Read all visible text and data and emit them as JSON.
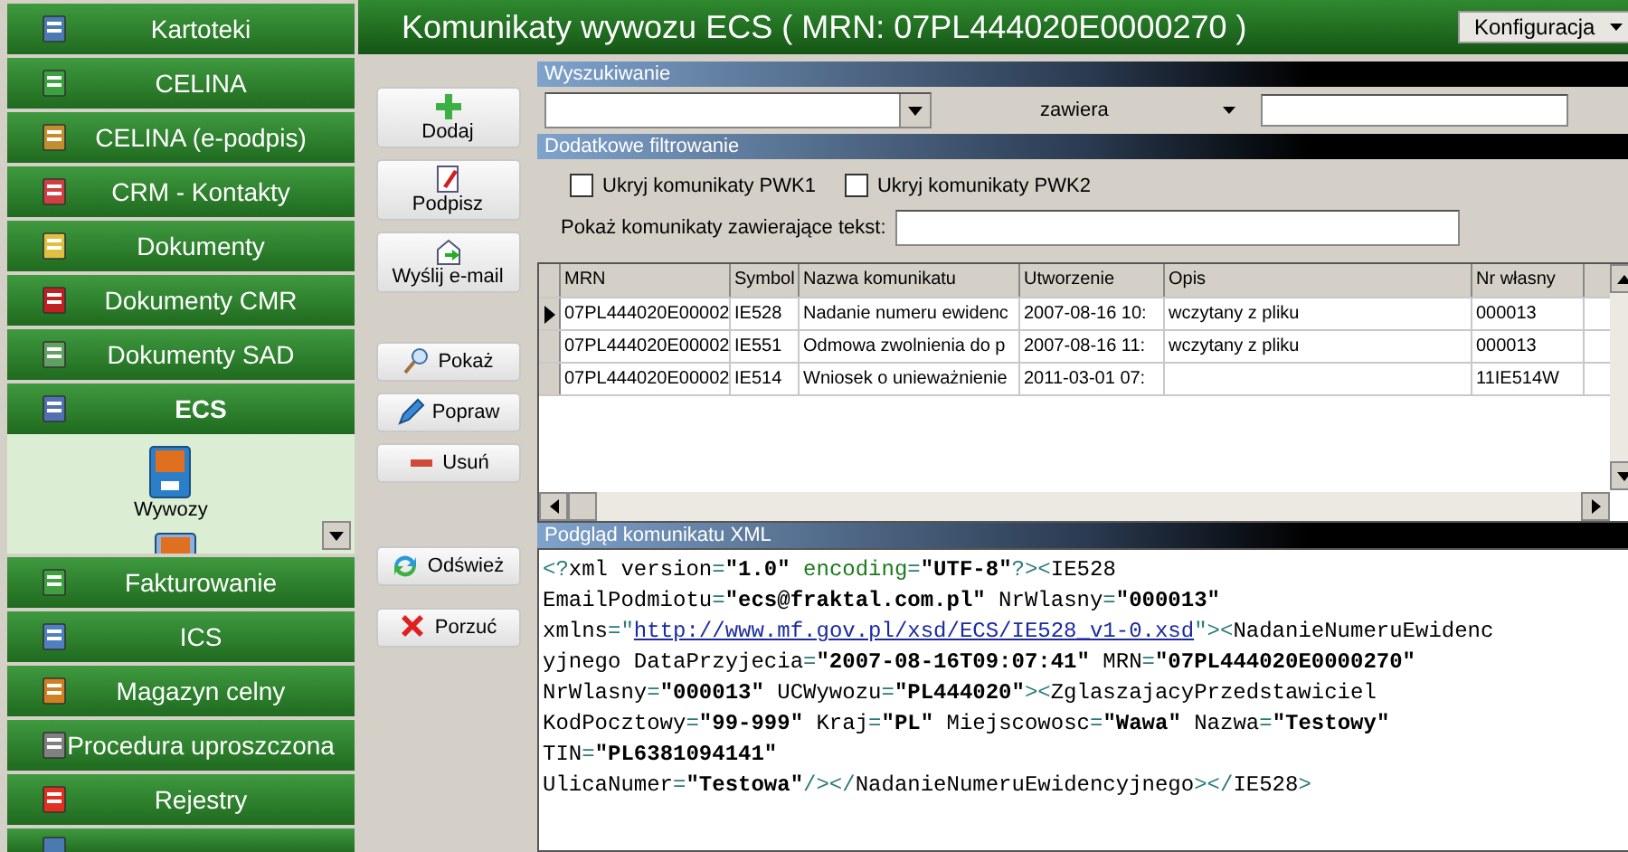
{
  "sidebar": {
    "items": [
      {
        "label": "Kartoteki",
        "expanded": false
      },
      {
        "label": "CELINA",
        "expanded": false
      },
      {
        "label": "CELINA (e-podpis)",
        "expanded": false
      },
      {
        "label": "CRM - Kontakty",
        "expanded": false
      },
      {
        "label": "Dokumenty",
        "expanded": false
      },
      {
        "label": "Dokumenty CMR",
        "expanded": false
      },
      {
        "label": "Dokumenty SAD",
        "expanded": false
      },
      {
        "label": "ECS",
        "expanded": true,
        "children": [
          {
            "label": "Wywozy"
          }
        ]
      },
      {
        "label": "Fakturowanie",
        "expanded": false
      },
      {
        "label": "ICS",
        "expanded": false
      },
      {
        "label": "Magazyn celny",
        "expanded": false
      },
      {
        "label": "Procedura uproszczona",
        "expanded": false
      },
      {
        "label": "Rejestry",
        "expanded": false
      }
    ]
  },
  "header": {
    "title": "Komunikaty wywozu ECS ( MRN: 07PL444020E0000270 )",
    "menu": "Konfiguracja"
  },
  "actions": [
    [
      {
        "label": "Dodaj",
        "kind": "add"
      },
      {
        "label": "Podpisz",
        "kind": "sign"
      },
      {
        "label": "Wyślij e-mail",
        "kind": "email"
      }
    ],
    [
      {
        "label": "Pokaż",
        "kind": "show"
      },
      {
        "label": "Popraw",
        "kind": "edit"
      },
      {
        "label": "Usuń",
        "kind": "delete"
      }
    ],
    [
      {
        "label": "Odśwież",
        "kind": "refresh"
      },
      {
        "label": "Porzuć",
        "kind": "discard"
      }
    ]
  ],
  "search": {
    "title": "Wyszukiwanie",
    "operator": "zawiera"
  },
  "filter": {
    "title": "Dodatkowe filtrowanie",
    "options": [
      {
        "label": "Ukryj komunikaty PWK1",
        "checked": false
      },
      {
        "label": "Ukryj komunikaty PWK2",
        "checked": false
      }
    ],
    "text_label": "Pokaż komunikaty zawierające tekst:"
  },
  "table": {
    "columns": [
      "MRN",
      "Symbol",
      "Nazwa komunikatu",
      "Utworzenie",
      "Opis",
      "Nr własny"
    ],
    "rows": [
      {
        "selected": true,
        "cells": [
          "07PL444020E00002",
          "IE528",
          "Nadanie numeru ewidenc",
          "2007-08-16 10:",
          "wczytany z pliku",
          "000013"
        ]
      },
      {
        "selected": false,
        "cells": [
          "07PL444020E00002",
          "IE551",
          "Odmowa zwolnienia do p",
          "2007-08-16 11:",
          "wczytany z pliku",
          "000013"
        ]
      },
      {
        "selected": false,
        "cells": [
          "07PL444020E00002",
          "IE514",
          "Wniosek o unieważnienie",
          "2011-03-01 07:",
          "",
          "11IE514W"
        ]
      }
    ]
  },
  "xml": {
    "title": "Podgląd komunikatu XML",
    "lines": [
      [
        {
          "kind": "p",
          "text": "<?"
        },
        {
          "kind": "n",
          "text": "xml version"
        },
        {
          "kind": "p",
          "text": "="
        },
        {
          "kind": "v",
          "text": "\"1.0\""
        },
        {
          "kind": "k",
          "text": " encoding"
        },
        {
          "kind": "p",
          "text": "="
        },
        {
          "kind": "v",
          "text": "\"UTF-8\""
        },
        {
          "kind": "p",
          "text": "?><"
        },
        {
          "kind": "n",
          "text": "IE528"
        }
      ],
      [
        {
          "kind": "n",
          "text": "EmailPodmiotu"
        },
        {
          "kind": "p",
          "text": "="
        },
        {
          "kind": "v",
          "text": "\"ecs@fraktal.com.pl\""
        },
        {
          "kind": "n",
          "text": " NrWlasny"
        },
        {
          "kind": "p",
          "text": "="
        },
        {
          "kind": "v",
          "text": "\"000013\""
        }
      ],
      [
        {
          "kind": "n",
          "text": "xmlns"
        },
        {
          "kind": "p",
          "text": "=\""
        },
        {
          "kind": "l",
          "text": "http://www.mf.gov.pl/xsd/ECS/IE528_v1-0.xsd"
        },
        {
          "kind": "p",
          "text": "\"><"
        },
        {
          "kind": "n",
          "text": "NadanieNumeruEwidenc"
        }
      ],
      [
        {
          "kind": "n",
          "text": "yjnego DataPrzyjecia"
        },
        {
          "kind": "p",
          "text": "="
        },
        {
          "kind": "v",
          "text": "\"2007-08-16T09:07:41\""
        },
        {
          "kind": "n",
          "text": " MRN"
        },
        {
          "kind": "p",
          "text": "="
        },
        {
          "kind": "v",
          "text": "\"07PL444020E0000270\""
        }
      ],
      [
        {
          "kind": "n",
          "text": "NrWlasny"
        },
        {
          "kind": "p",
          "text": "="
        },
        {
          "kind": "v",
          "text": "\"000013\""
        },
        {
          "kind": "n",
          "text": " UCWywozu"
        },
        {
          "kind": "p",
          "text": "="
        },
        {
          "kind": "v",
          "text": "\"PL444020\""
        },
        {
          "kind": "p",
          "text": "><"
        },
        {
          "kind": "n",
          "text": "ZglaszajacyPrzedstawiciel"
        }
      ],
      [
        {
          "kind": "n",
          "text": "KodPocztowy"
        },
        {
          "kind": "p",
          "text": "="
        },
        {
          "kind": "v",
          "text": "\"99-999\""
        },
        {
          "kind": "n",
          "text": " Kraj"
        },
        {
          "kind": "p",
          "text": "="
        },
        {
          "kind": "v",
          "text": "\"PL\""
        },
        {
          "kind": "n",
          "text": " Miejscowosc"
        },
        {
          "kind": "p",
          "text": "="
        },
        {
          "kind": "v",
          "text": "\"Wawa\""
        },
        {
          "kind": "n",
          "text": " Nazwa"
        },
        {
          "kind": "p",
          "text": "="
        },
        {
          "kind": "v",
          "text": "\"Testowy\""
        }
      ],
      [
        {
          "kind": "n",
          "text": "TIN"
        },
        {
          "kind": "p",
          "text": "="
        },
        {
          "kind": "v",
          "text": "\"PL6381094141\""
        }
      ],
      [
        {
          "kind": "n",
          "text": "UlicaNumer"
        },
        {
          "kind": "p",
          "text": "="
        },
        {
          "kind": "v",
          "text": "\"Testowa\""
        },
        {
          "kind": "p",
          "text": "/></"
        },
        {
          "kind": "n",
          "text": "NadanieNumeruEwidencyjnego"
        },
        {
          "kind": "p",
          "text": "></"
        },
        {
          "kind": "n",
          "text": "IE528"
        },
        {
          "kind": "p",
          "text": ">"
        }
      ]
    ]
  }
}
